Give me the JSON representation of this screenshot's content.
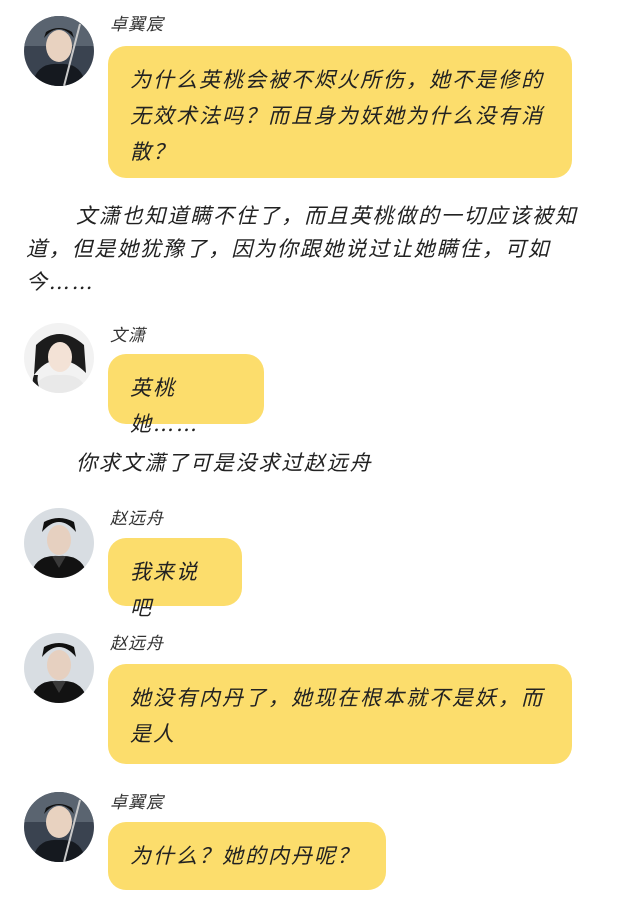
{
  "speakers": {
    "zhuo": "卓翼宸",
    "wenxiao": "文潇",
    "zhao": "赵远舟"
  },
  "messages": [
    {
      "speaker": "卓翼宸",
      "text": "为什么英桃会被不烬火所伤，她不是修的无效术法吗？而且身为妖她为什么没有消散？"
    },
    {
      "speaker": "文潇",
      "text": "英桃她……"
    },
    {
      "speaker": "赵远舟",
      "text": "我来说吧"
    },
    {
      "speaker": "赵远舟",
      "text": "她没有内丹了，她现在根本就不是妖，而是人"
    },
    {
      "speaker": "卓翼宸",
      "text": "为什么？她的内丹呢？"
    }
  ],
  "narrations": [
    "文潇也知道瞒不住了，而且英桃做的一切应该被知道，但是她犹豫了，因为你跟她说过让她瞒住，可如今……",
    "你求文潇了可是没求过赵远舟"
  ],
  "colors": {
    "bubble": "#fcdd6c",
    "text": "#222222",
    "background": "#ffffff"
  }
}
